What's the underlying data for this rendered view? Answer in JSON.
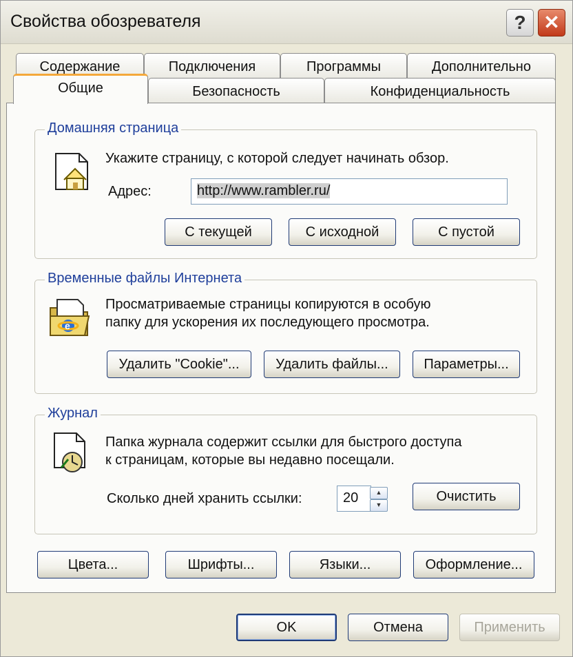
{
  "window": {
    "title": "Свойства обозревателя",
    "help_glyph": "?",
    "close_glyph": "✕"
  },
  "tabs_back": [
    "Содержание",
    "Подключения",
    "Программы",
    "Дополнительно"
  ],
  "tabs_front": [
    "Общие",
    "Безопасность",
    "Конфиденциальность"
  ],
  "active_tab": "Общие",
  "home": {
    "legend": "Домашняя страница",
    "hint": "Укажите страницу, с которой следует начинать обзор.",
    "address_label": "Адрес:",
    "address_value": "http://www.rambler.ru/",
    "btn_current": "С текущей",
    "btn_default": "С исходной",
    "btn_blank": "С пустой"
  },
  "temp": {
    "legend": "Временные файлы Интернета",
    "line1": "Просматриваемые страницы копируются в особую",
    "line2": "папку для ускорения их последующего просмотра.",
    "btn_cookies": "Удалить \"Cookie\"...",
    "btn_files": "Удалить файлы...",
    "btn_settings": "Параметры..."
  },
  "history": {
    "legend": "Журнал",
    "line1": "Папка журнала содержит ссылки для быстрого доступа",
    "line2": "к страницам, которые вы недавно посещали.",
    "days_label": "Сколько дней хранить ссылки:",
    "days_value": "20",
    "btn_clear": "Очистить"
  },
  "bottom": {
    "colors": "Цвета...",
    "fonts": "Шрифты...",
    "languages": "Языки...",
    "accessibility": "Оформление..."
  },
  "dialog": {
    "ok": "OK",
    "cancel": "Отмена",
    "apply": "Применить"
  },
  "icons": {
    "help": "help-icon",
    "close": "close-icon",
    "home": "home-page-icon",
    "temp": "folder-ie-icon",
    "history": "history-clock-icon"
  }
}
